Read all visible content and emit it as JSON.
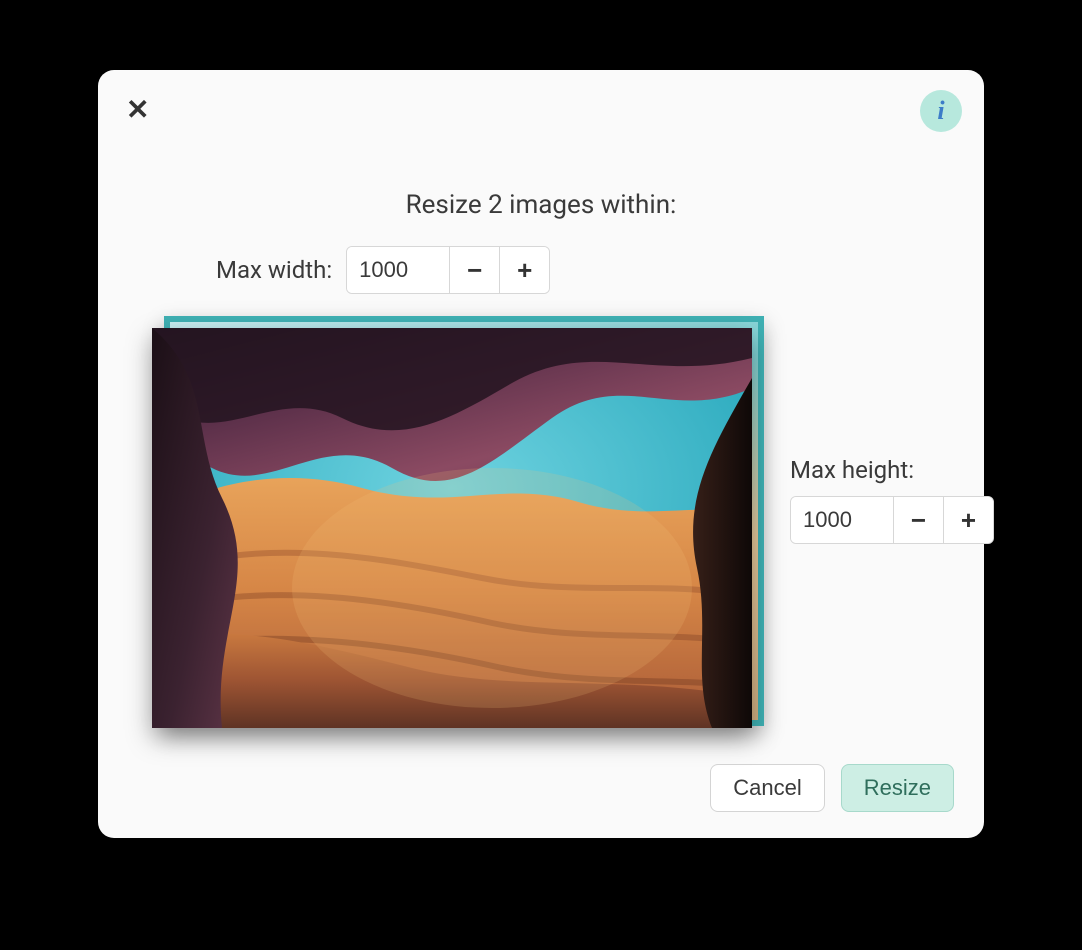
{
  "dialog": {
    "title": "Resize 2 images within:",
    "max_width_label": "Max width:",
    "max_height_label": "Max height:",
    "max_width_value": "1000",
    "max_height_value": "1000",
    "cancel_label": "Cancel",
    "resize_label": "Resize",
    "info_icon_text": "i",
    "close_icon_text": "✕",
    "minus_glyph": "−",
    "plus_glyph": "+"
  }
}
